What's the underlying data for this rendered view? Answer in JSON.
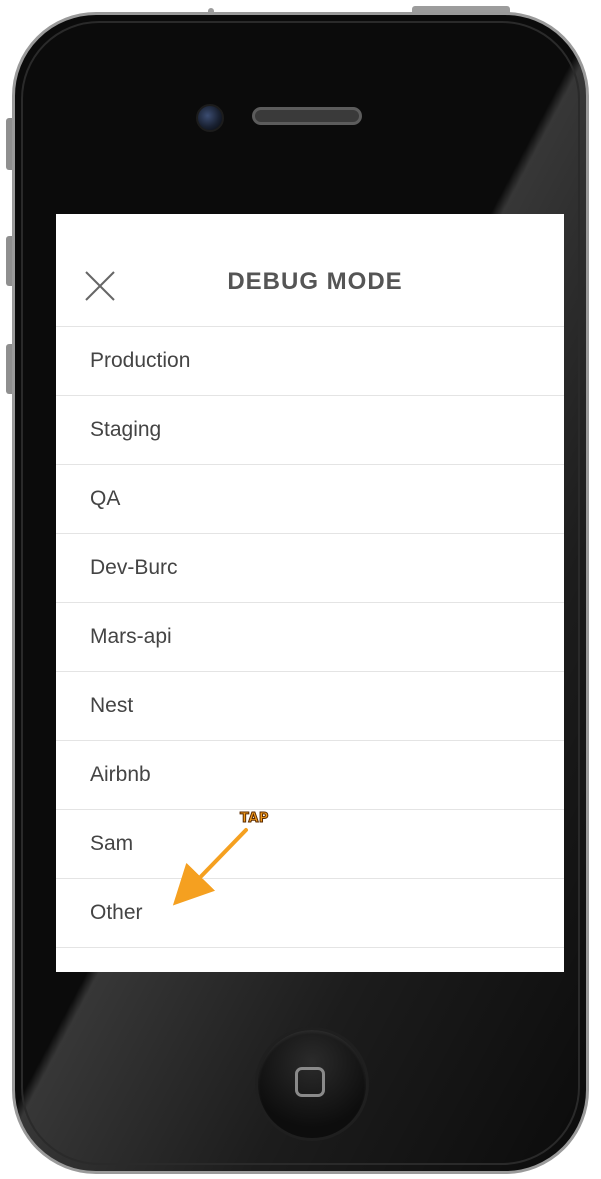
{
  "header": {
    "title": "DEBUG MODE",
    "close_icon": "close-icon"
  },
  "environments": [
    {
      "label": "Production"
    },
    {
      "label": "Staging"
    },
    {
      "label": "QA"
    },
    {
      "label": "Dev-Burc"
    },
    {
      "label": "Mars-api"
    },
    {
      "label": "Nest"
    },
    {
      "label": "Airbnb"
    },
    {
      "label": "Sam"
    },
    {
      "label": "Other"
    }
  ],
  "annotation": {
    "label": "TAP",
    "color": "#f5a020",
    "icon": "arrow-icon"
  },
  "device": {
    "home_icon": "home-square-icon",
    "camera_icon": "camera-icon",
    "speaker_icon": "speaker-icon"
  }
}
